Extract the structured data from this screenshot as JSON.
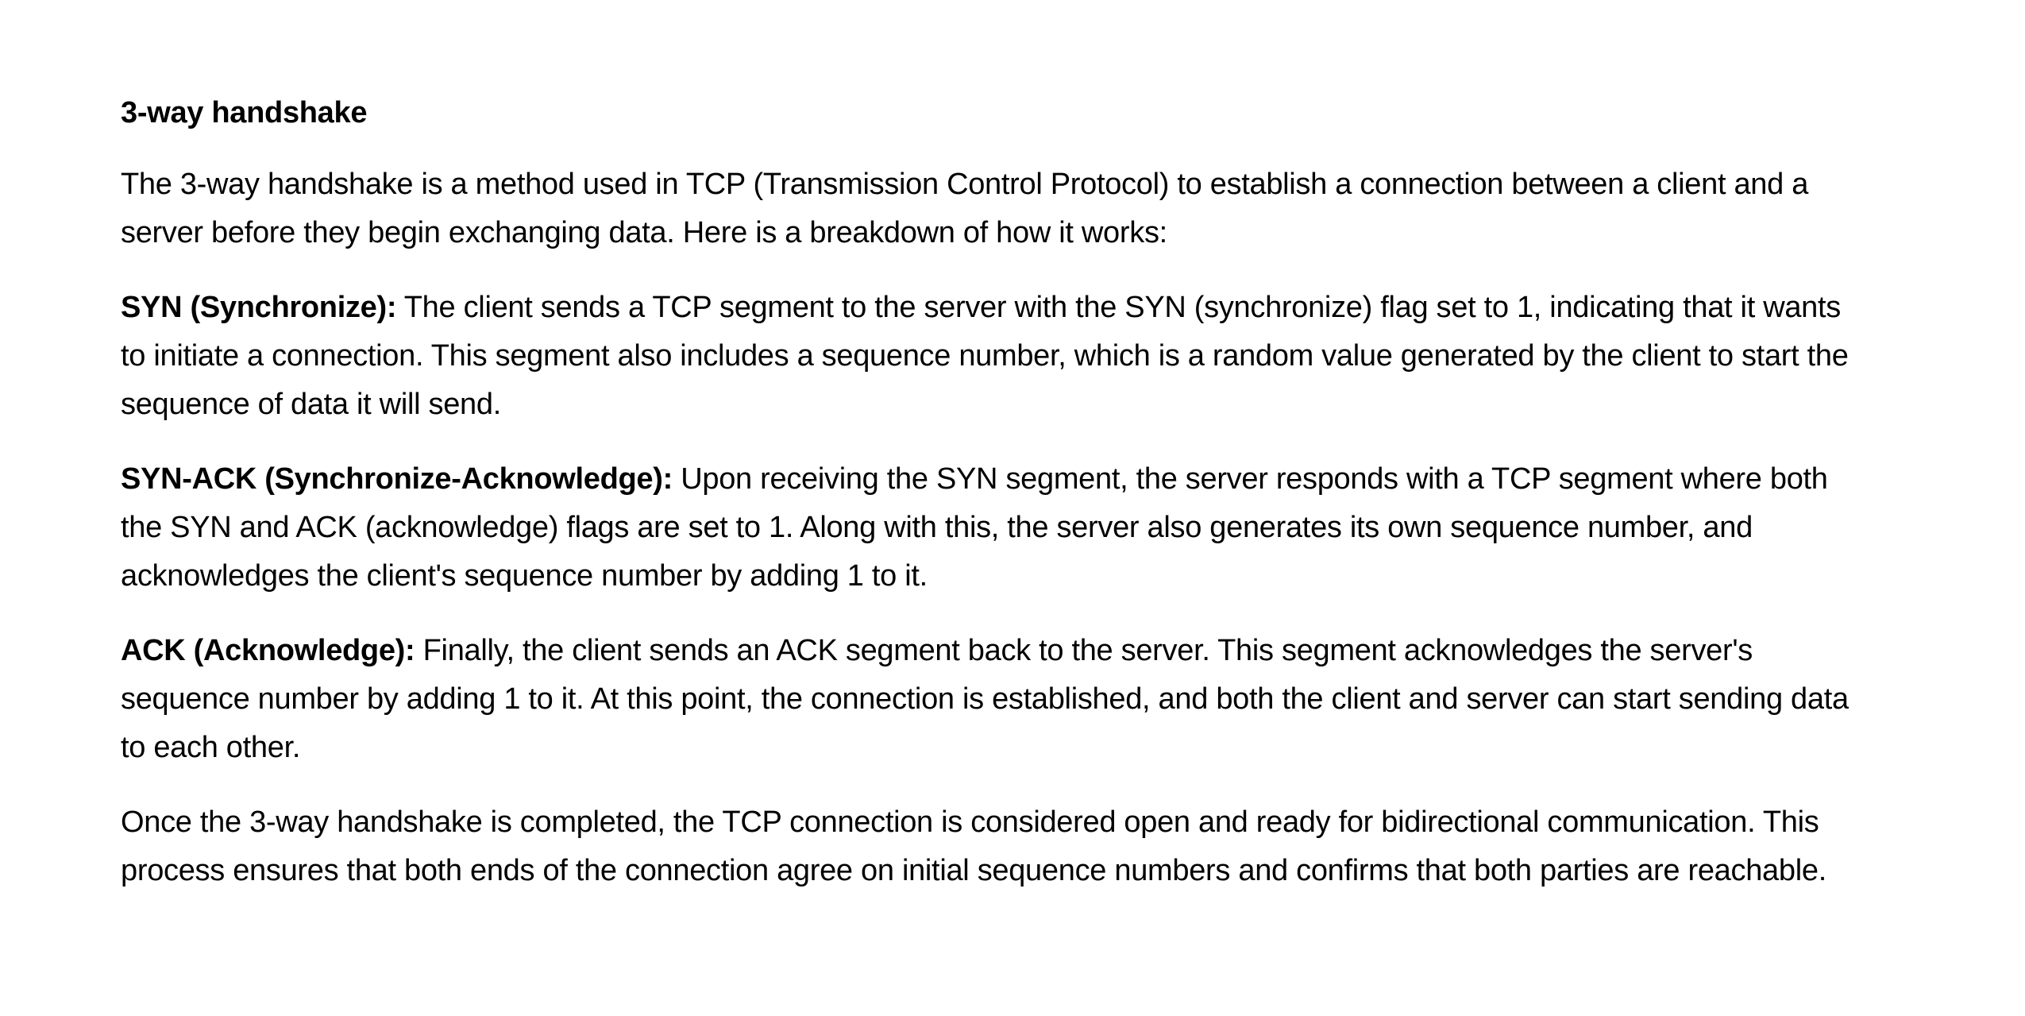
{
  "document": {
    "title": "3-way handshake",
    "intro": "The 3-way handshake is a method used in TCP (Transmission Control Protocol) to establish a connection between a client and a server before they begin exchanging data. Here is a breakdown of how it works:",
    "steps": [
      {
        "term": "SYN (Synchronize):",
        "text": " The client sends a TCP segment to the server with the SYN (synchronize) flag set to 1, indicating that it wants to initiate a connection. This segment also includes a sequence number, which is a random value generated by the client to start the sequence of data it will send."
      },
      {
        "term": "SYN-ACK (Synchronize-Acknowledge):",
        "text": " Upon receiving the SYN segment, the server responds with a TCP segment where both the SYN and ACK (acknowledge) flags are set to 1. Along with this, the server also generates its own sequence number, and acknowledges the client's sequence number by adding 1 to it."
      },
      {
        "term": "ACK (Acknowledge):",
        "text": " Finally, the client sends an ACK segment back to the server. This segment acknowledges the server's sequence number by adding 1 to it. At this point, the connection is established, and both the client and server can start sending data to each other."
      }
    ],
    "conclusion": "Once the 3-way handshake is completed, the TCP connection is considered open and ready for bidirectional communication. This process ensures that both ends of the connection agree on initial sequence numbers and confirms that both parties are reachable."
  }
}
